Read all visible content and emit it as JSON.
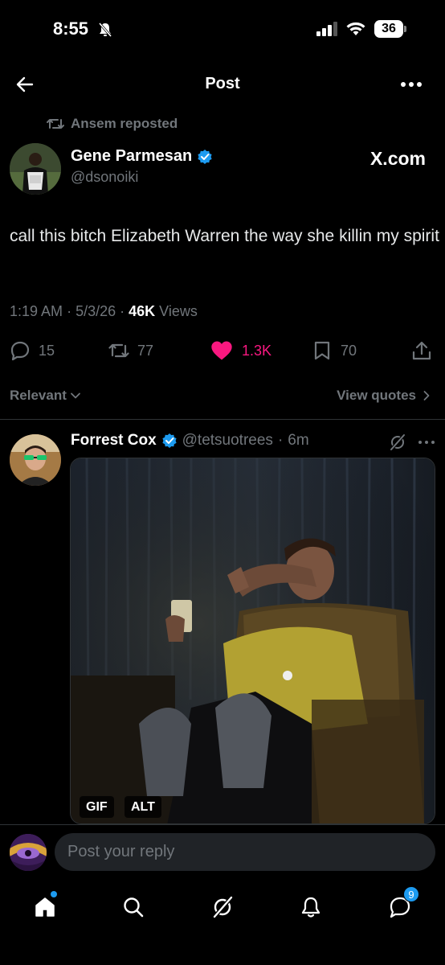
{
  "status_bar": {
    "time": "8:55",
    "battery": "36",
    "icons": [
      "bell-slash-icon",
      "signal-icon",
      "wifi-icon",
      "battery-icon"
    ]
  },
  "header": {
    "title": "Post",
    "back_icon": "back-arrow-icon",
    "more_icon": "more-icon"
  },
  "post": {
    "repost_label": "Ansem reposted",
    "author_name": "Gene Parmesan",
    "author_handle": "@dsonoiki",
    "source_label": "X.com",
    "text": "call this bitch Elizabeth Warren the way she killin my spirit",
    "time": "1:19 AM",
    "date": "5/3/26",
    "views_count": "46K",
    "views_label": "Views",
    "actions": {
      "replies": "15",
      "reposts": "77",
      "likes": "1.3K",
      "bookmarks": "70"
    },
    "accent_colors": {
      "like": "#f91880",
      "verified": "#1d9bf0"
    }
  },
  "filters": {
    "sort_label": "Relevant",
    "view_quotes": "View quotes"
  },
  "reply": {
    "name": "Forrest Cox",
    "handle": "@tetsuotrees",
    "age": "6m",
    "badges": [
      "GIF",
      "ALT"
    ]
  },
  "composer": {
    "placeholder": "Post your reply"
  },
  "tabbar": {
    "items": [
      "home-icon",
      "search-icon",
      "grok-icon",
      "notifications-icon",
      "messages-icon"
    ],
    "messages_badge": "9"
  }
}
